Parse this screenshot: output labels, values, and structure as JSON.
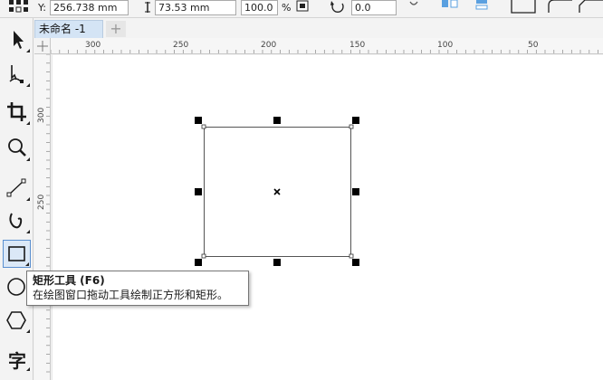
{
  "property_bar": {
    "y_label": "Y:",
    "y_value": "256.738 mm",
    "height_value": "73.53 mm",
    "scale_value": "100.0",
    "scale_unit": "%",
    "angle_value": "0.0"
  },
  "document_tab": {
    "title": "未命名 -1",
    "add_label": "+"
  },
  "ruler": {
    "horizontal_ticks": [
      "300",
      "250",
      "200",
      "150",
      "100",
      "50"
    ],
    "vertical_ticks": [
      "300",
      "250"
    ]
  },
  "tools": [
    {
      "name": "pick-tool",
      "icon": "arrow-pointer-icon"
    },
    {
      "name": "shape-tool",
      "icon": "node-edit-icon"
    },
    {
      "name": "crop-tool",
      "icon": "crop-icon"
    },
    {
      "name": "zoom-tool",
      "icon": "magnifier-icon"
    },
    {
      "name": "freehand-tool",
      "icon": "line-pen-icon"
    },
    {
      "name": "artistic-media-tool",
      "icon": "curve-brush-icon"
    },
    {
      "name": "rectangle-tool",
      "icon": "rectangle-icon",
      "active": true
    },
    {
      "name": "ellipse-tool",
      "icon": "ellipse-icon"
    },
    {
      "name": "polygon-tool",
      "icon": "hexagon-icon"
    },
    {
      "name": "text-tool",
      "icon": "text-char-icon",
      "glyph": "字"
    }
  ],
  "tooltip": {
    "title": "矩形工具 (F6)",
    "description": "在绘图窗口拖动工具绘制正方形和矩形。"
  },
  "colors": {
    "active_tool_bg": "#dbe8f7",
    "active_tool_border": "#5a8fd0",
    "tab_bg": "#d4e4f5",
    "handle": "#000000"
  }
}
